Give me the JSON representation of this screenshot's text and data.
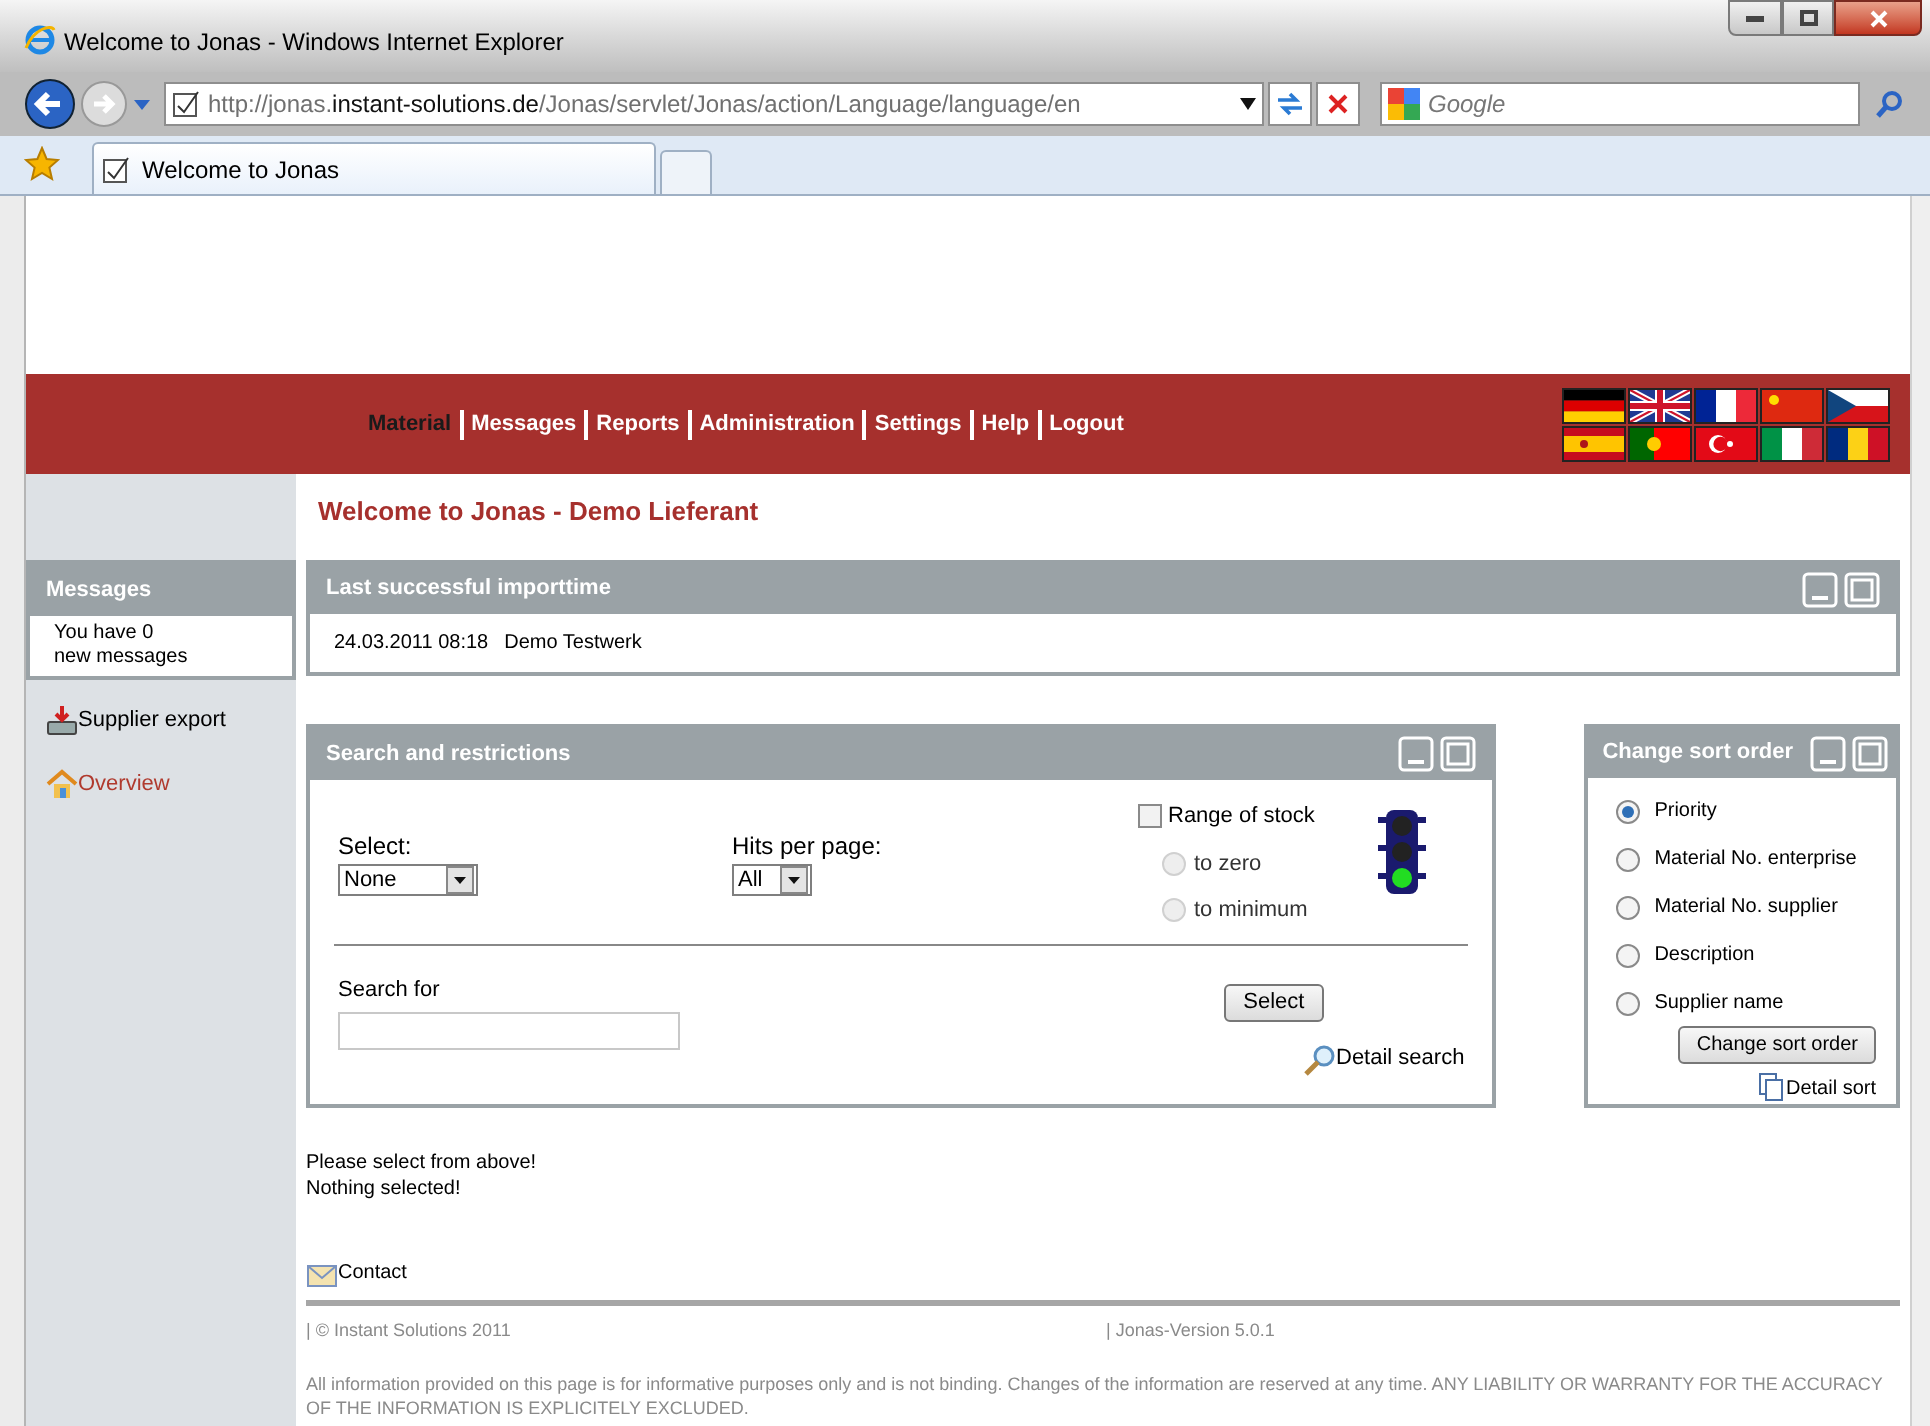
{
  "browser": {
    "title": "Welcome to Jonas - Windows Internet Explorer",
    "url": "http://jonas.**instant-solutions.de**/Jonas/servlet/Jonas/action/Language/language/en",
    "search_placeholder": "Google",
    "tab": "Welcome to Jonas"
  },
  "nav": [
    {
      "label": "Material",
      "selected": true
    },
    {
      "label": "Messages",
      "selected": false
    },
    {
      "label": "Reports",
      "selected": false
    },
    {
      "label": "Administration",
      "selected": false
    },
    {
      "label": "Settings",
      "selected": false
    },
    {
      "label": "Help",
      "selected": false
    },
    {
      "label": "Logout",
      "selected": false
    }
  ],
  "heading": "Welcome to Jonas - Demo Lieferant",
  "sidebar": {
    "messages_title": "Messages",
    "messages_lines": [
      "You have 0",
      "new messages"
    ],
    "links": [
      {
        "label": "Supplier export",
        "kind": "export"
      },
      {
        "label": "Overview",
        "kind": "home"
      }
    ]
  },
  "import_panel": {
    "title": "Last successful importtime",
    "date": "24.03.2011 08:18",
    "plant": "Demo Testwerk"
  },
  "search_panel": {
    "title": "Search and restrictions",
    "select_label": "Select:",
    "select_value": "None",
    "hits_label": "Hits per page:",
    "hits_value": "All",
    "range_label": "Range of stock",
    "range_checked": false,
    "range_options": [
      {
        "label": "to zero",
        "selected": false,
        "disabled": true
      },
      {
        "label": "to minimum",
        "selected": false,
        "disabled": true
      }
    ],
    "search_label": "Search for",
    "button": "Select",
    "detail": "Detail search"
  },
  "sort_panel": {
    "title": "Change sort order",
    "options": [
      {
        "label": "Priority",
        "selected": true
      },
      {
        "label": "Material No. enterprise",
        "selected": false
      },
      {
        "label": "Material No. supplier",
        "selected": false
      },
      {
        "label": "Description",
        "selected": false
      },
      {
        "label": "Supplier name",
        "selected": false
      }
    ],
    "button": "Change sort order",
    "detail": "Detail sort"
  },
  "messages": [
    "Please select from above!",
    "Nothing selected!"
  ],
  "contact": "Contact",
  "footer": {
    "copyright": "| © Instant Solutions 2011",
    "version": "| Jonas-Version 5.0.1",
    "disclaimer": "All information provided on this page is for informative purposes only and is not binding. Changes of the information are reserved at any time. ANY LIABILITY OR WARRANTY FOR THE ACCURACY OF THE INFORMATION IS EXPLICITELY EXCLUDED."
  }
}
